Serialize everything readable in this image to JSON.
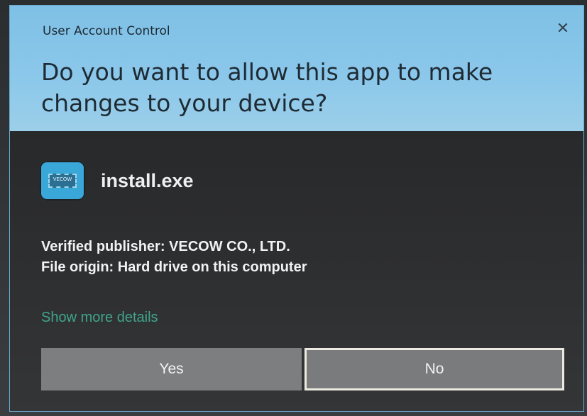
{
  "dialog": {
    "window_title": "User Account Control",
    "close_glyph": "✕",
    "question": "Do you want to allow this app to make changes to your device?",
    "app": {
      "name": "install.exe",
      "icon_name": "vecow-chip-icon",
      "icon_text": "VECOW"
    },
    "publisher_line": "Verified publisher: VECOW CO., LTD.",
    "origin_line": "File origin: Hard drive on this computer",
    "more_details_link": "Show more details",
    "buttons": {
      "yes": "Yes",
      "no": "No"
    },
    "colors": {
      "header_bg": "#8cc8ea",
      "body_bg": "#2e2f31",
      "link": "#3fa58b",
      "button_bg": "#7d7e80"
    }
  }
}
